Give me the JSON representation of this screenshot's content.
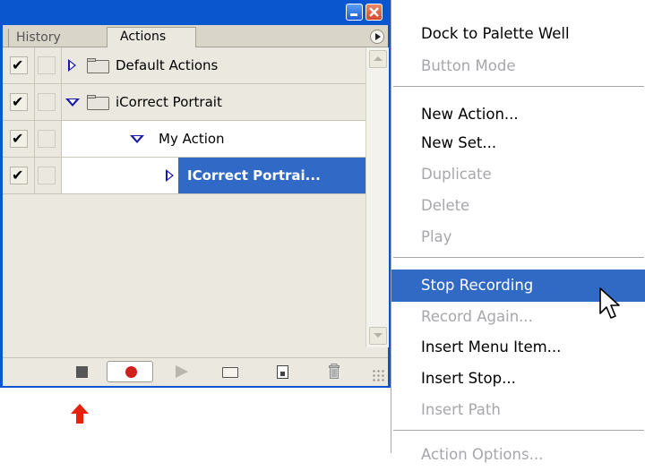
{
  "palette": {
    "tabs": [
      "History",
      "Actions"
    ],
    "rows": [
      {
        "checked": true,
        "label": "Default Actions"
      },
      {
        "checked": true,
        "label": "iCorrect Portrait"
      },
      {
        "checked": true,
        "label": "My Action"
      },
      {
        "checked": true,
        "label": "ICorrect Portrai..."
      }
    ],
    "bottom_icons": [
      "stop-icon",
      "record-icon",
      "play-icon",
      "new-set-icon",
      "new-action-icon",
      "trash-icon"
    ]
  },
  "menu": {
    "items": [
      {
        "label": "Dock to Palette Well",
        "state": "enabled"
      },
      {
        "label": "Button Mode",
        "state": "disabled"
      },
      {
        "label": "New Action...",
        "state": "enabled"
      },
      {
        "label": "New Set...",
        "state": "enabled"
      },
      {
        "label": "Duplicate",
        "state": "disabled"
      },
      {
        "label": "Delete",
        "state": "disabled"
      },
      {
        "label": "Play",
        "state": "disabled"
      },
      {
        "label": "Stop Recording",
        "state": "highlighted"
      },
      {
        "label": "Record Again...",
        "state": "disabled"
      },
      {
        "label": "Insert Menu Item...",
        "state": "enabled"
      },
      {
        "label": "Insert Stop...",
        "state": "enabled"
      },
      {
        "label": "Insert Path",
        "state": "disabled"
      },
      {
        "label": "Action Options...",
        "state": "disabled"
      }
    ]
  },
  "colors": {
    "title_bar": "#0a56cf",
    "selection": "#316ac5",
    "record": "#d0201c",
    "arrow": "#e8200f"
  }
}
